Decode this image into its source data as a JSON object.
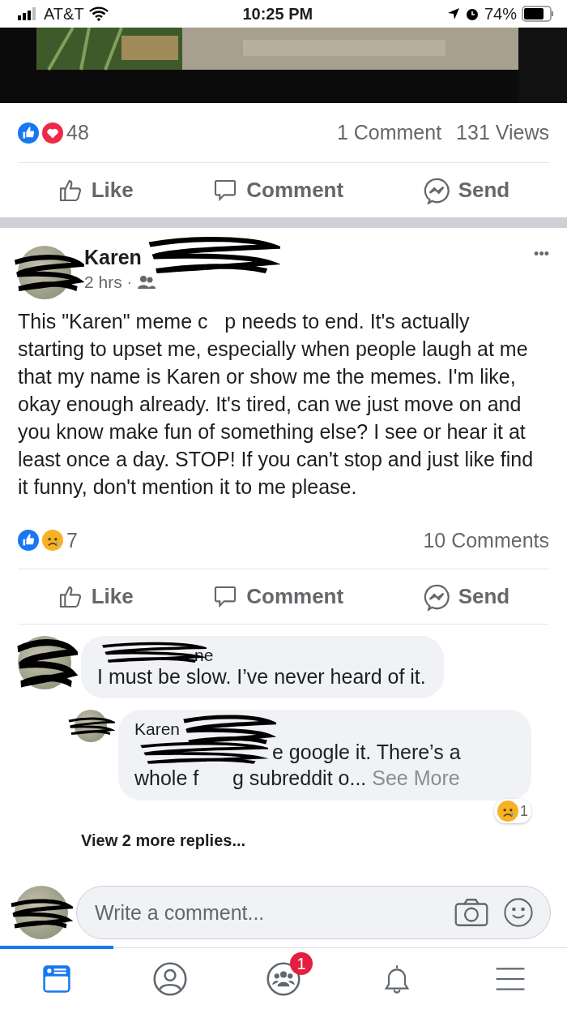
{
  "status_bar": {
    "carrier": "AT&T",
    "time": "10:25 PM",
    "battery": "74%"
  },
  "previous_post": {
    "reaction_count": "48",
    "comments": "1 Comment",
    "views": "131 Views",
    "actions": [
      "Like",
      "Comment",
      "Send"
    ]
  },
  "post": {
    "author": "Karen",
    "time": "2 hrs",
    "audience_separator": "·",
    "more": "•••",
    "body": "This \"Karen\" meme c   p needs to end. It's actually starting to upset me, especially when people laugh at me that my name is Karen or show me the memes. I'm like, okay enough already. It's tired, can we just move on and you know make fun of something else? I see or hear it at least once a day. STOP! If you can't stop and just like find it funny, don't mention it to me please.",
    "reaction_count": "7",
    "comments": "10 Comments",
    "actions": [
      "Like",
      "Comment",
      "Send"
    ]
  },
  "comments": [
    {
      "author": "ne",
      "text": "I must be slow. I’ve never heard of it.",
      "replies": [
        {
          "author": "Karen",
          "text_lines": [
            "e google it. There’s a",
            "whole f      g subreddit o..."
          ],
          "see_more": "See More",
          "reaction_count": "1"
        }
      ]
    }
  ],
  "view_replies": "View 2 more replies...",
  "composer": {
    "placeholder": "Write a comment..."
  },
  "tab_bar": [
    {
      "kind": "feed",
      "selected": true
    },
    {
      "kind": "profile",
      "selected": false
    },
    {
      "kind": "groups",
      "selected": false,
      "badge": "1"
    },
    {
      "kind": "bell",
      "selected": false
    },
    {
      "kind": "menu",
      "selected": false
    }
  ]
}
